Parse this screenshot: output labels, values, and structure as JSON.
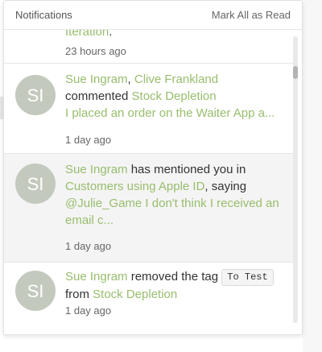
{
  "header": {
    "title": "Notifications",
    "mark_all": "Mark All as Read"
  },
  "notifications": [
    {
      "tail": "Iteration",
      "tail_punct": ".",
      "time": "23 hours ago"
    },
    {
      "avatar": "SI",
      "user1": "Sue Ingram",
      "sep": ",",
      "user2": "Clive Frankland",
      "verb": "commented",
      "target": "Stock Depletion",
      "excerpt": "I placed an order on the Waiter App a...",
      "time": "1 day ago"
    },
    {
      "avatar": "SI",
      "user": "Sue Ingram",
      "verb": "has mentioned you in",
      "target": "Customers using Apple ID",
      "saying": ", saying",
      "excerpt": "@Julie_Game I don't think I received an email c...",
      "time": "1 day ago"
    },
    {
      "avatar": "SI",
      "user": "Sue Ingram",
      "verb": "removed the tag",
      "tag": "To Test",
      "from": "from",
      "target": "Stock Depletion",
      "time": "1 day ago"
    }
  ]
}
